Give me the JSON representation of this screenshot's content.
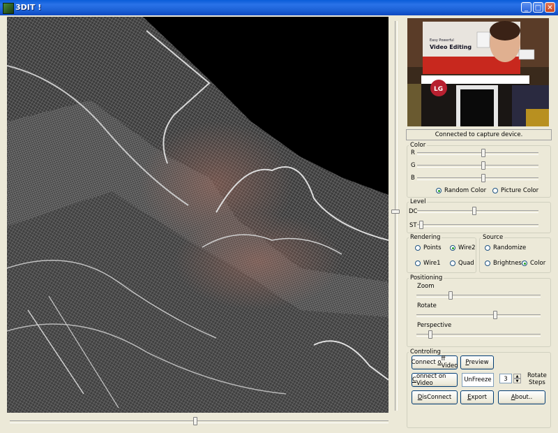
{
  "window": {
    "title": "3DIT !"
  },
  "titlebar": {
    "min_glyph": "_",
    "max_glyph": "□",
    "close_glyph": "✕"
  },
  "status": "Connected to capture device.",
  "preview_scene": {
    "banner_line1": "Easy Powerful",
    "banner_line2": "Video Editing",
    "brand": "LG"
  },
  "color_group": {
    "legend": "Color",
    "r": "R",
    "g": "G",
    "b": "B",
    "random": "Random Color",
    "picture": "Picture Color",
    "selected": "random",
    "r_level": 0.55,
    "g_level": 0.55,
    "b_level": 0.55
  },
  "level_group": {
    "legend": "Level",
    "dc": "DC",
    "st": "ST",
    "dc_level": 0.47,
    "st_level": 0.02
  },
  "rendering_group": {
    "legend": "Rendering",
    "points": "Points",
    "wire2": "Wire2",
    "wire1": "Wire1",
    "quad": "Quad",
    "selected": "wire2"
  },
  "source_group": {
    "legend": "Source",
    "randomize": "Randomize",
    "brightness": "Brightness",
    "color": "Color",
    "selected": "color"
  },
  "positioning_group": {
    "legend": "Positioning",
    "zoom": "Zoom",
    "rotate": "Rotate",
    "perspective": "Perspective",
    "zoom_level": 0.27,
    "rotate_level": 0.64,
    "perspective_level": 0.1
  },
  "controling_group": {
    "legend": "Controling",
    "connect_off_pre": "Connect ",
    "connect_off_u": "o",
    "connect_off_post": "ff Video",
    "preview_u": "P",
    "preview_post": "review",
    "connect_on_pre": "",
    "connect_on_u": "C",
    "connect_on_post": "onnect on Video",
    "unfreeze": "UnFreeze",
    "steps_value": "3",
    "rotate_steps_1": "Rotate",
    "rotate_steps_2": "Steps",
    "disconnect_u": "D",
    "disconnect_post": "isConnect",
    "export_u": "E",
    "export_post": "xport",
    "about_u": "A",
    "about_post": "bout..",
    "spin_up": "▲",
    "spin_down": "▼"
  },
  "sliders": {
    "bottom_level": 0.49,
    "vertical_level": 0.49
  }
}
